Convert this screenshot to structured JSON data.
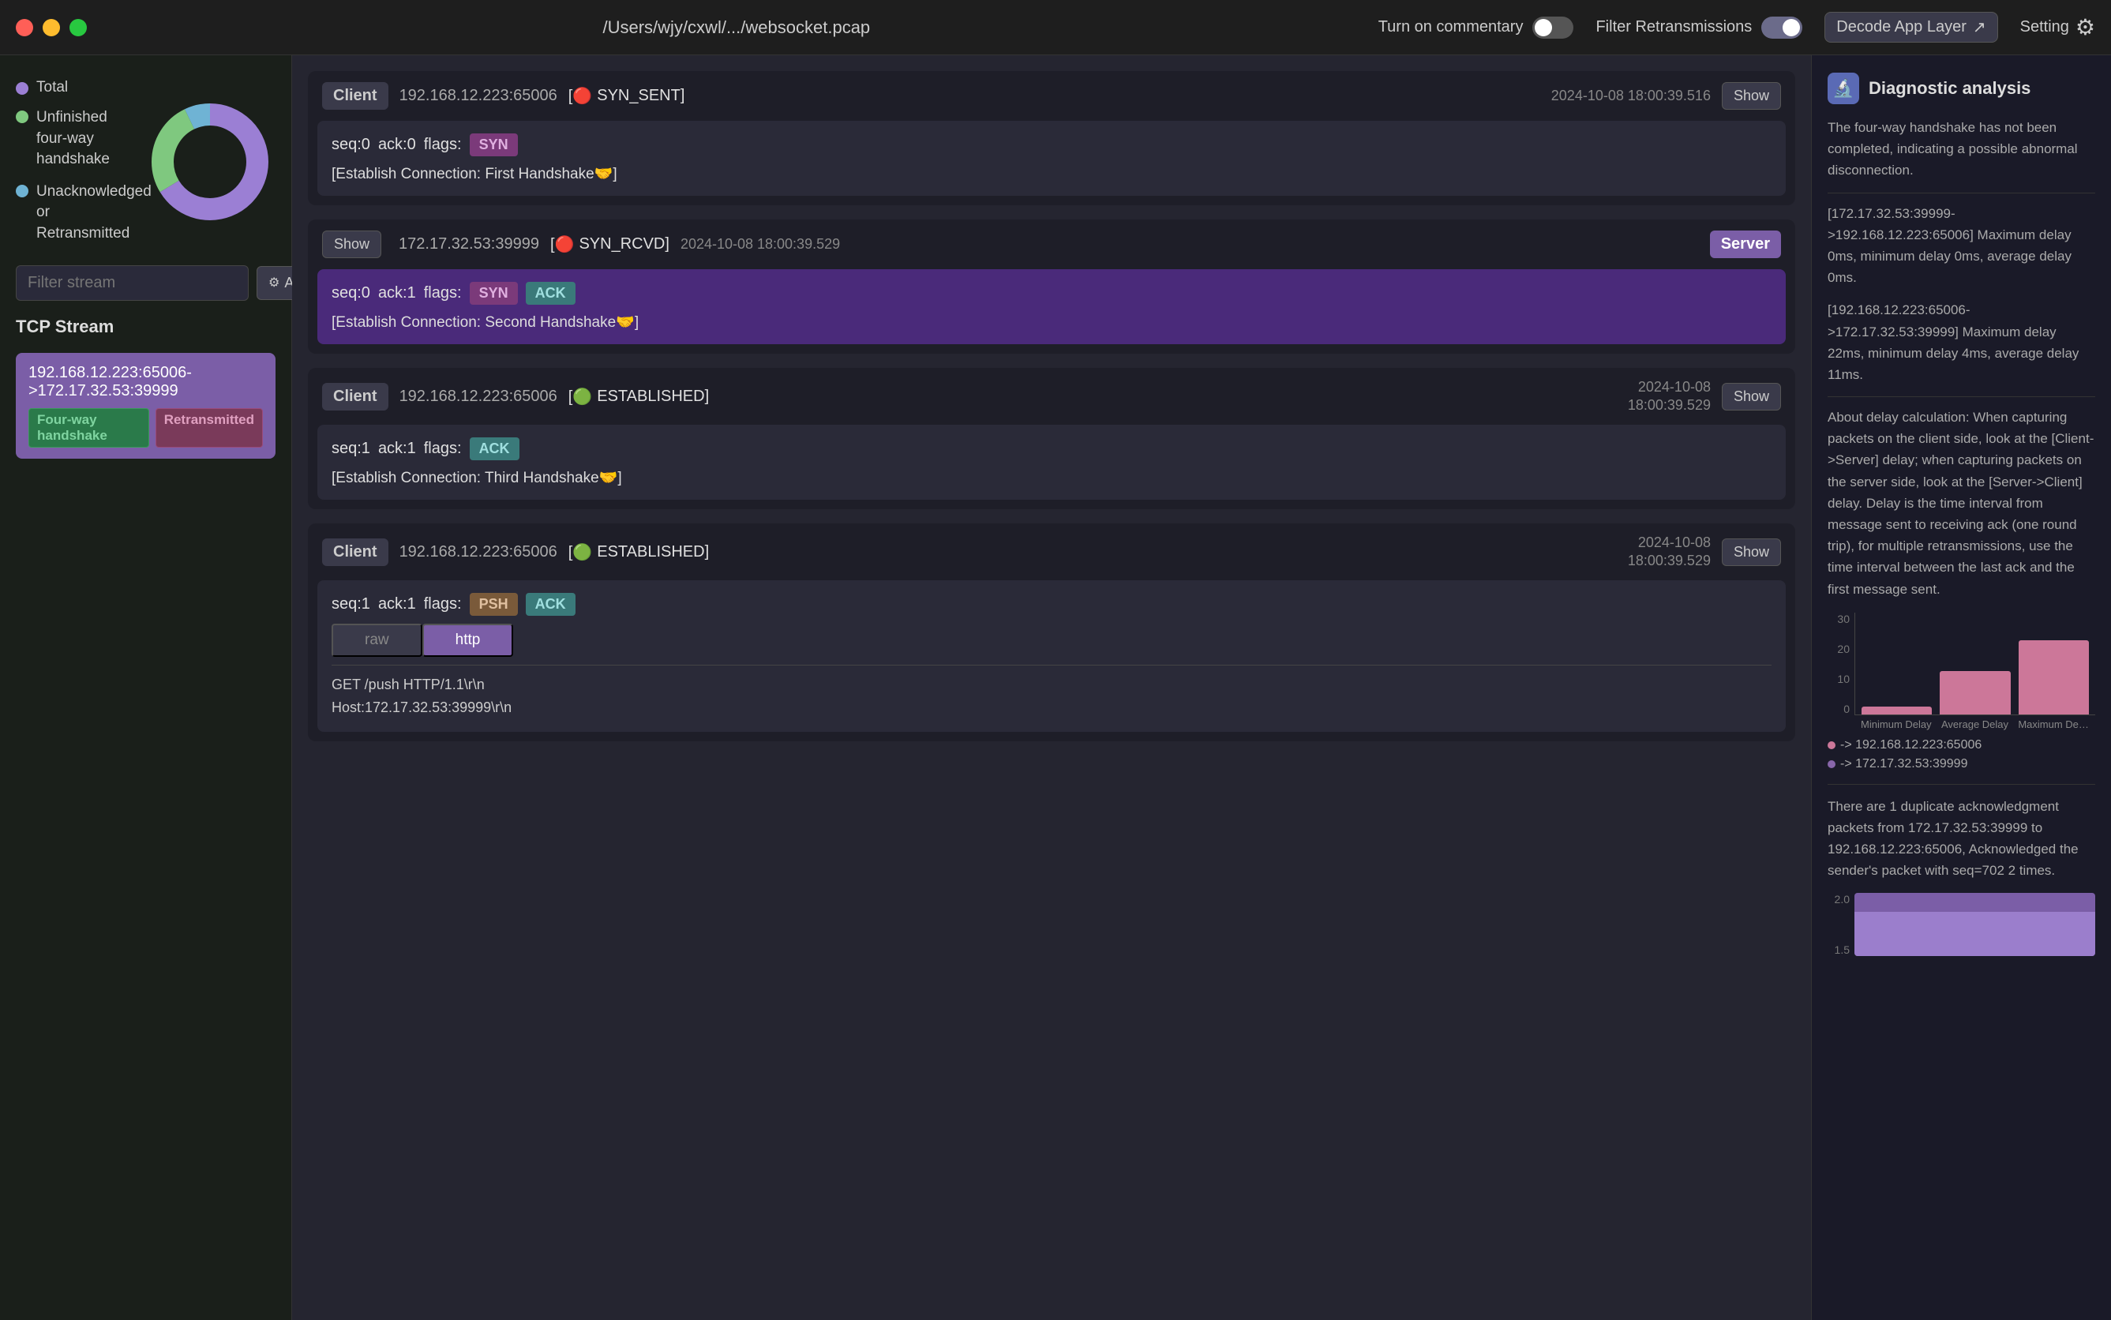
{
  "titlebar": {
    "path": "/Users/wjy/cxwl/.../websocket.pcap",
    "commentary_label": "Turn on commentary",
    "filter_retrans_label": "Filter Retransmissions",
    "decode_label": "Decode App Layer",
    "setting_label": "Setting"
  },
  "sidebar": {
    "legend": [
      {
        "id": "total",
        "label": "Total",
        "color": "dot-purple"
      },
      {
        "id": "unfinished",
        "label": "Unfinished four-way handshake",
        "color": "dot-green"
      },
      {
        "id": "unack",
        "label": "Unacknowledged or Retransmitted",
        "color": "dot-blue"
      }
    ],
    "filter_placeholder": "Filter stream",
    "advanced_search": "Advanced search",
    "tcp_stream_label": "TCP Stream",
    "streams": [
      {
        "ip": "192.168.12.223:65006->172.17.32.53:39999",
        "badges": [
          "Four-way handshake",
          "Retransmitted"
        ]
      }
    ]
  },
  "packets": [
    {
      "id": "pkt1",
      "node": "Client",
      "ip": "192.168.12.223:65006",
      "status_icon": "🔴",
      "status_text": "SYN_SENT",
      "time": "2024-10-08 18:00:39.516",
      "show_label": "Show",
      "seq": "0",
      "ack": "0",
      "flags": [
        "SYN"
      ],
      "message": "[Establish Connection: First Handshake🤝]"
    },
    {
      "id": "pkt2",
      "node": "Server",
      "ip": "172.17.32.53:39999",
      "status_icon": "🔴",
      "status_text": "SYN_RCVD",
      "time": "2024-10-08 18:00:39.529",
      "show_label": "Show",
      "seq": "0",
      "ack": "1",
      "flags": [
        "SYN",
        "ACK"
      ],
      "message": "[Establish Connection: Second Handshake🤝]",
      "style": "purple"
    },
    {
      "id": "pkt3",
      "node": "Client",
      "ip": "192.168.12.223:65006",
      "status_icon": "🟢",
      "status_text": "ESTABLISHED",
      "time": "2024-10-08 18:00:39.529",
      "show_label": "Show",
      "seq": "1",
      "ack": "1",
      "flags": [
        "ACK"
      ],
      "message": "[Establish Connection: Third Handshake🤝]"
    },
    {
      "id": "pkt4",
      "node": "Client",
      "ip": "192.168.12.223:65006",
      "status_icon": "🟢",
      "status_text": "ESTABLISHED",
      "time": "2024-10-08 18:00:39.529",
      "show_label": "Show",
      "seq": "1",
      "ack": "1",
      "flags": [
        "PSH",
        "ACK"
      ],
      "http_tabs": [
        "raw",
        "http"
      ],
      "active_tab": "http",
      "http_content": "GET /push HTTP/1.1\\r\\n\nHost:172.17.32.53:39999\\r\\n"
    }
  ],
  "diagnostics": {
    "title": "Diagnostic analysis",
    "summary": "The four-way handshake has not been completed, indicating a possible abnormal disconnection.",
    "delay_info_1": "[172.17.32.53:39999->192.168.12.223:65006] Maximum delay 0ms, minimum delay 0ms, average delay 0ms.",
    "delay_info_2": "[192.168.12.223:65006->172.17.32.53:39999] Maximum delay 22ms, minimum delay 4ms, average delay 11ms.",
    "delay_note": "About delay calculation: When capturing packets on the client side, look at the [Client->Server] delay; when capturing packets on the server side, look at the [Server->Client] delay. Delay is the time interval from message sent to receiving ack (one round trip), for multiple retransmissions, use the time interval between the last ack and the first message sent.",
    "chart": {
      "y_max": "30",
      "y_mid": "20",
      "y_low": "10",
      "y_zero": "0",
      "bars": [
        {
          "label": "Minimum Delay",
          "height_pct": 8,
          "color": "#cc7799"
        },
        {
          "label": "Average Delay",
          "height_pct": 42,
          "color": "#cc7799"
        },
        {
          "label": "Maximum Del...",
          "height_pct": 72,
          "color": "#cc7799"
        }
      ],
      "legend": [
        {
          "label": "->  192.168.12.223:65006",
          "color": "lc-pink"
        },
        {
          "label": "->  172.17.32.53:39999",
          "color": "lc-purple"
        }
      ]
    },
    "dup_ack": "There are 1 duplicate acknowledgment packets from 172.17.32.53:39999 to 192.168.12.223:65006, Acknowledged the sender's packet with seq=702 2 times.",
    "chart2": {
      "y_top": "2.0",
      "y_mid": "1.5"
    }
  }
}
